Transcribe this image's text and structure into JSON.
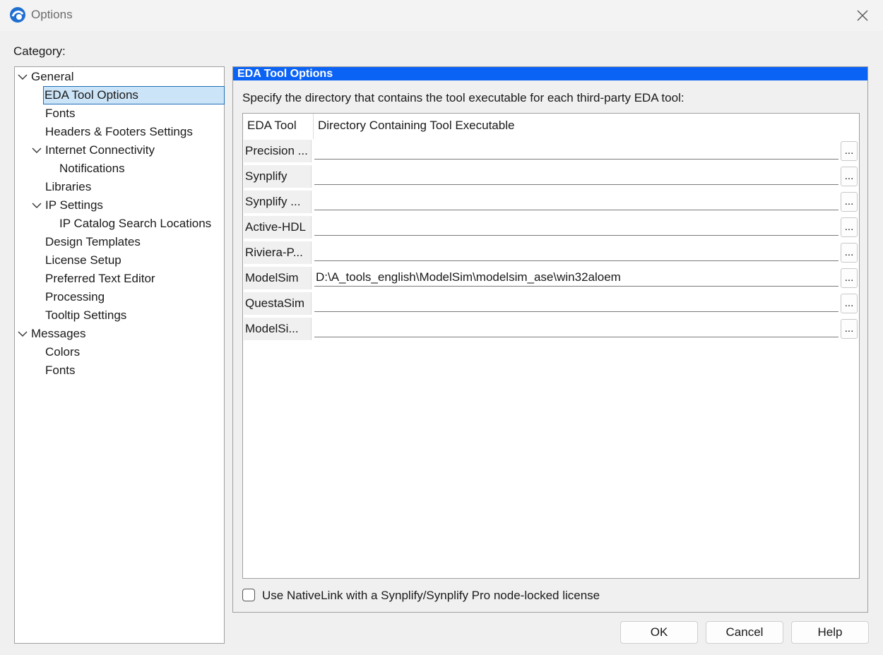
{
  "window": {
    "title": "Options",
    "icons": {
      "app": "quartus-app-icon",
      "close": "close-icon"
    }
  },
  "category_label": "Category:",
  "tree": {
    "items": [
      {
        "label": "General",
        "expanded": true
      },
      {
        "label": "EDA Tool Options",
        "selected": true
      },
      {
        "label": "Fonts"
      },
      {
        "label": "Headers & Footers Settings"
      },
      {
        "label": "Internet Connectivity",
        "expanded": true
      },
      {
        "label": "Notifications"
      },
      {
        "label": "Libraries"
      },
      {
        "label": "IP Settings",
        "expanded": true
      },
      {
        "label": "IP Catalog Search Locations"
      },
      {
        "label": "Design Templates"
      },
      {
        "label": "License Setup"
      },
      {
        "label": "Preferred Text Editor"
      },
      {
        "label": "Processing"
      },
      {
        "label": "Tooltip Settings"
      },
      {
        "label": "Messages",
        "expanded": true
      },
      {
        "label": "Colors"
      },
      {
        "label": "Fonts"
      }
    ]
  },
  "panel": {
    "header": "EDA Tool Options",
    "description": "Specify the directory that contains the tool executable for each third-party EDA tool:",
    "table": {
      "columns": [
        "EDA Tool",
        "Directory Containing Tool Executable"
      ],
      "browse_label": "...",
      "rows": [
        {
          "tool": "Precision ...",
          "path": ""
        },
        {
          "tool": "Synplify",
          "path": ""
        },
        {
          "tool": "Synplify ...",
          "path": ""
        },
        {
          "tool": "Active-HDL",
          "path": ""
        },
        {
          "tool": "Riviera-P...",
          "path": ""
        },
        {
          "tool": "ModelSim",
          "path": "D:\\A_tools_english\\ModelSim\\modelsim_ase\\win32aloem"
        },
        {
          "tool": "QuestaSim",
          "path": ""
        },
        {
          "tool": "ModelSi...",
          "path": ""
        }
      ]
    },
    "nativelink_checkbox": {
      "label": "Use NativeLink with a Synplify/Synplify Pro node-locked license",
      "checked": false
    }
  },
  "buttons": {
    "ok": "OK",
    "cancel": "Cancel",
    "help": "Help"
  },
  "colors": {
    "header_bg": "#0b63f5",
    "selection_bg": "#cce4f7",
    "selection_border": "#1d6fb8"
  }
}
